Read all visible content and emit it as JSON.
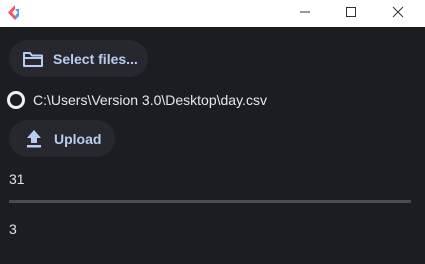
{
  "colors": {
    "background": "#1c1d20",
    "titlebar": "#ffffff",
    "button_bg": "#26282e",
    "button_text": "#b9cdf2",
    "logo_left": "#ff4f5a",
    "logo_right": "#3b82f6"
  },
  "window": {
    "controls": {
      "minimize_icon": "minimize-icon",
      "maximize_icon": "maximize-icon",
      "close_icon": "close-icon"
    }
  },
  "file_picker": {
    "select_label": "Select files...",
    "icon": "folder-icon"
  },
  "selected_file": {
    "path": "C:\\Users\\Version 3.0\\Desktop\\day.csv"
  },
  "upload": {
    "label": "Upload",
    "icon": "upload-icon"
  },
  "output": {
    "top_value": "31",
    "bottom_value": "3"
  }
}
